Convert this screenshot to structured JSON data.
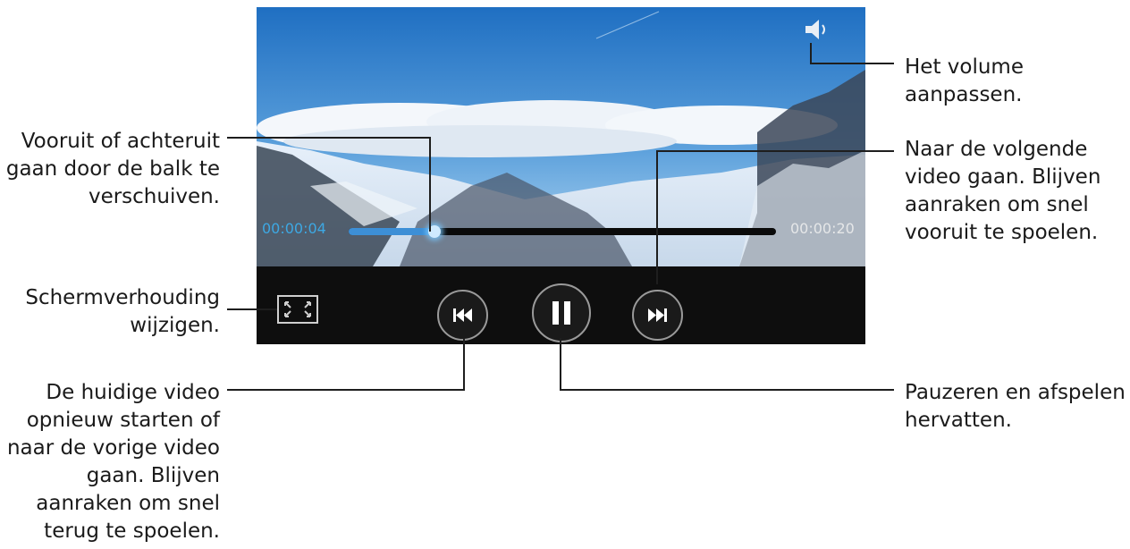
{
  "player": {
    "time_current": "00:00:04",
    "time_total": "00:00:20",
    "progress": 0.2
  },
  "callouts": {
    "seek": "Vooruit of achteruit\ngaan door de balk te\nverschuiven.",
    "aspect": "Schermverhouding\nwijzigen.",
    "prev": "De huidige video\nopnieuw starten of\nnaar de vorige video\ngaan. Blijven\naanraken om snel\nterug te spoelen.",
    "volume": "Het volume\naanpassen.",
    "next": "Naar de volgende\nvideo gaan. Blijven\naanraken om snel\nvooruit te spoelen.",
    "pause": "Pauzeren en afspelen\nhervatten."
  },
  "icons": {
    "volume": "speaker-icon",
    "aspect": "aspect-ratio-icon",
    "prev": "skip-previous-icon",
    "pause": "pause-icon",
    "next": "skip-next-icon"
  },
  "colors": {
    "accent": "#3da8e3",
    "control_bar": "#0e0e0e"
  }
}
